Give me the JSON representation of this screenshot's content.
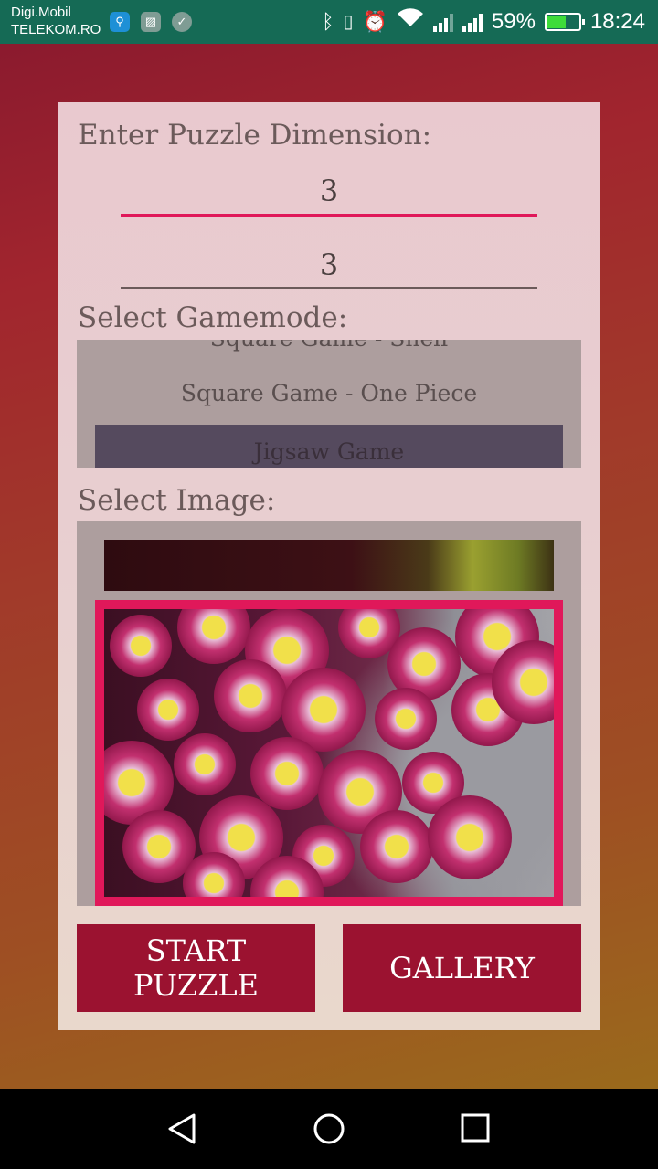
{
  "status_bar": {
    "carrier_line1": "Digi.Mobil",
    "carrier_line2": "TELEKOM.RO",
    "battery_percent": "59%",
    "time": "18:24",
    "battery_level": 0.59,
    "icons": [
      "usb-icon",
      "image-icon",
      "check-icon",
      "bluetooth-icon",
      "vibrate-icon",
      "alarm-icon",
      "wifi-icon",
      "signal-icon",
      "battery-icon"
    ]
  },
  "puzzle": {
    "dimension_label": "Enter Puzzle Dimension:",
    "rows_value": "3",
    "cols_value": "3",
    "gamemode_label": "Select Gamemode:",
    "gamemodes": {
      "partial_top": "Square Game - Shell",
      "middle": "Square Game - One Piece",
      "selected": "Jigsaw Game"
    },
    "image_label": "Select Image:"
  },
  "buttons": {
    "start": "START PUZZLE",
    "gallery": "GALLERY"
  },
  "colors": {
    "accent": "#e0185a",
    "button": "#9b1230",
    "status_bar": "#156a55"
  },
  "nav": {
    "icons": [
      "back-icon",
      "home-icon",
      "recents-icon"
    ]
  }
}
